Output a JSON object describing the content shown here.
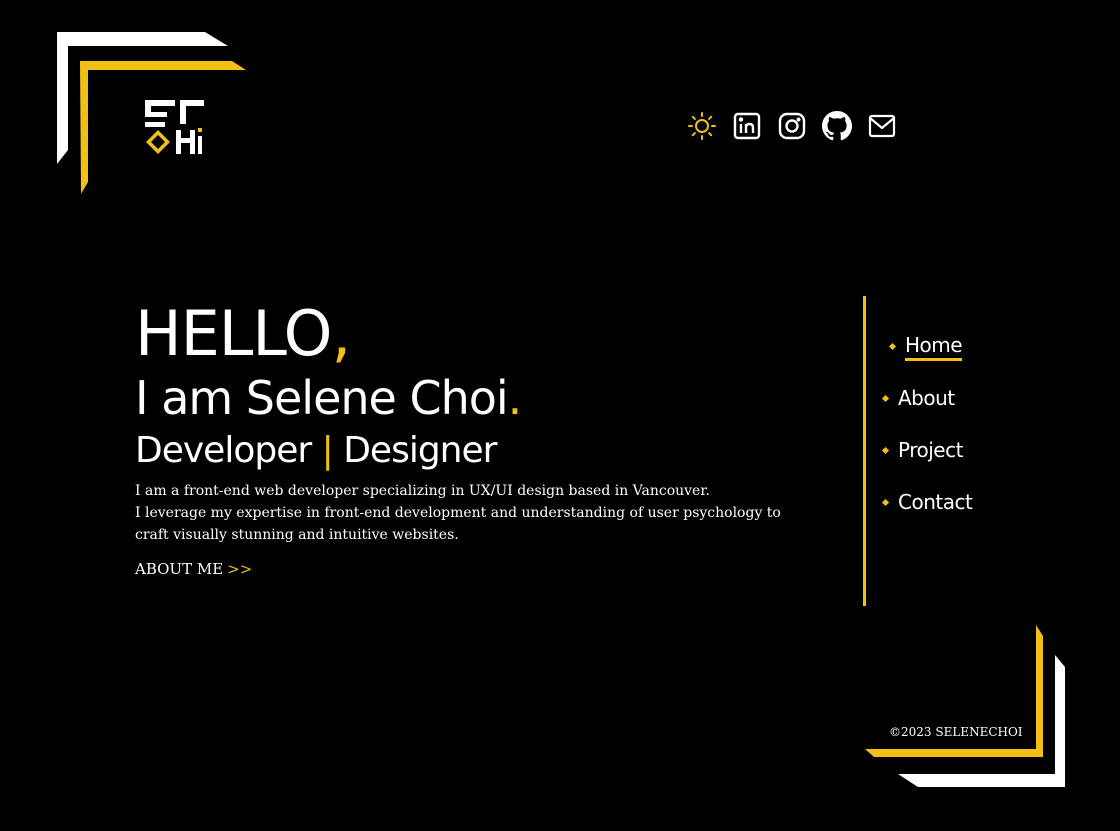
{
  "header": {
    "icons": [
      {
        "name": "sun-icon",
        "color": "#f2c014"
      },
      {
        "name": "linkedin-icon",
        "color": "#ffffff"
      },
      {
        "name": "instagram-icon",
        "color": "#ffffff"
      },
      {
        "name": "github-icon",
        "color": "#ffffff"
      },
      {
        "name": "mail-icon",
        "color": "#ffffff"
      }
    ]
  },
  "hero": {
    "hello": "HELLO",
    "hello_punct": ",",
    "intro": "I am Selene Choi",
    "intro_punct": ".",
    "role_left": "Developer",
    "role_sep": "|",
    "role_right": "Designer",
    "bio_line1": "I am a front-end web developer specializing in UX/UI design based in Vancouver.",
    "bio_line2": "I leverage my expertise in front-end development and understanding of user psychology to",
    "bio_line3": "craft visually stunning and intuitive websites.",
    "cta_label": "ABOUT ME",
    "cta_arrows": ">>"
  },
  "nav": {
    "items": [
      {
        "label": "Home",
        "active": true
      },
      {
        "label": "About",
        "active": false
      },
      {
        "label": "Project",
        "active": false
      },
      {
        "label": "Contact",
        "active": false
      }
    ]
  },
  "footer": {
    "copyright": "©2023 SELENECHOI"
  },
  "colors": {
    "background": "#000000",
    "accent": "#f2c014",
    "text": "#ffffff"
  }
}
